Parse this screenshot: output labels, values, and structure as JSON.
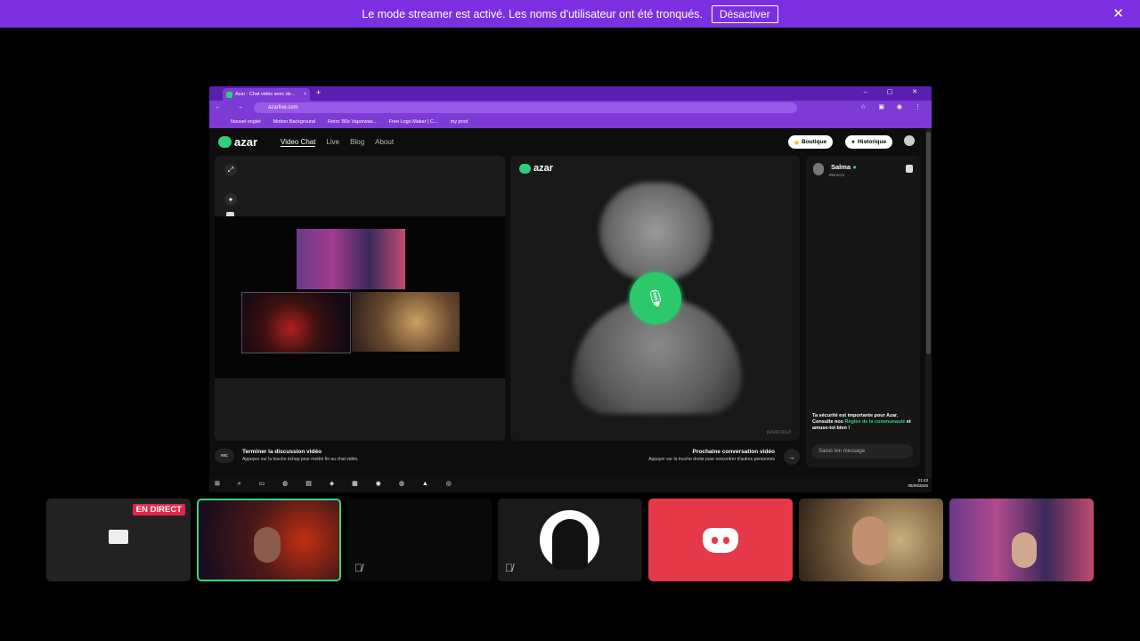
{
  "banner": {
    "message": "Le mode streamer est activé. Les noms d'utilisateur ont été tronqués.",
    "button": "Désactiver",
    "close_icon": "close-icon"
  },
  "browser": {
    "tab_title": "Azar : Chat vidéo avec de...",
    "tab_close": "×",
    "new_tab": "+",
    "url": "azarlive.com",
    "bookmarks": [
      "Nouvel onglet",
      "Motion Background",
      "Retro '80s Vaporwav...",
      "Free Logo Maker | C...",
      "my prod"
    ]
  },
  "site": {
    "logo": "azar",
    "nav": [
      "Video Chat",
      "Live",
      "Blog",
      "About"
    ],
    "shop_button": "Boutique",
    "history_button": "Historique",
    "partner": {
      "name": "Salma",
      "country": "Morocco"
    },
    "safety_text_1": "Ta sécurité est importante pour Azar. Consulte nos ",
    "safety_link": "Règles de la communauté",
    "safety_text_2": " et amuse-toi bien !",
    "chat_placeholder": "Saisis ton message",
    "video_id": "pkSAK3Da3",
    "end_chat": {
      "key": "esc",
      "title": "Terminer la discussion vidéo",
      "subtitle": "Appuyez sur la touche échap pour mettre fin au chat vidéo."
    },
    "next_chat": {
      "title": "Prochaine conversation vidéo",
      "subtitle": "Appuyer sur la touche droite pour rencontrer d'autres personnes",
      "arrow": "→"
    }
  },
  "taskbar": {
    "time": "01:43",
    "date": "05/09/2025"
  },
  "tiles": {
    "live_badge": "EN DIRECT"
  },
  "colors": {
    "banner": "#7b2fe0",
    "accent": "#2fd07a",
    "discord": "#e5394a",
    "live": "#e2264a"
  }
}
